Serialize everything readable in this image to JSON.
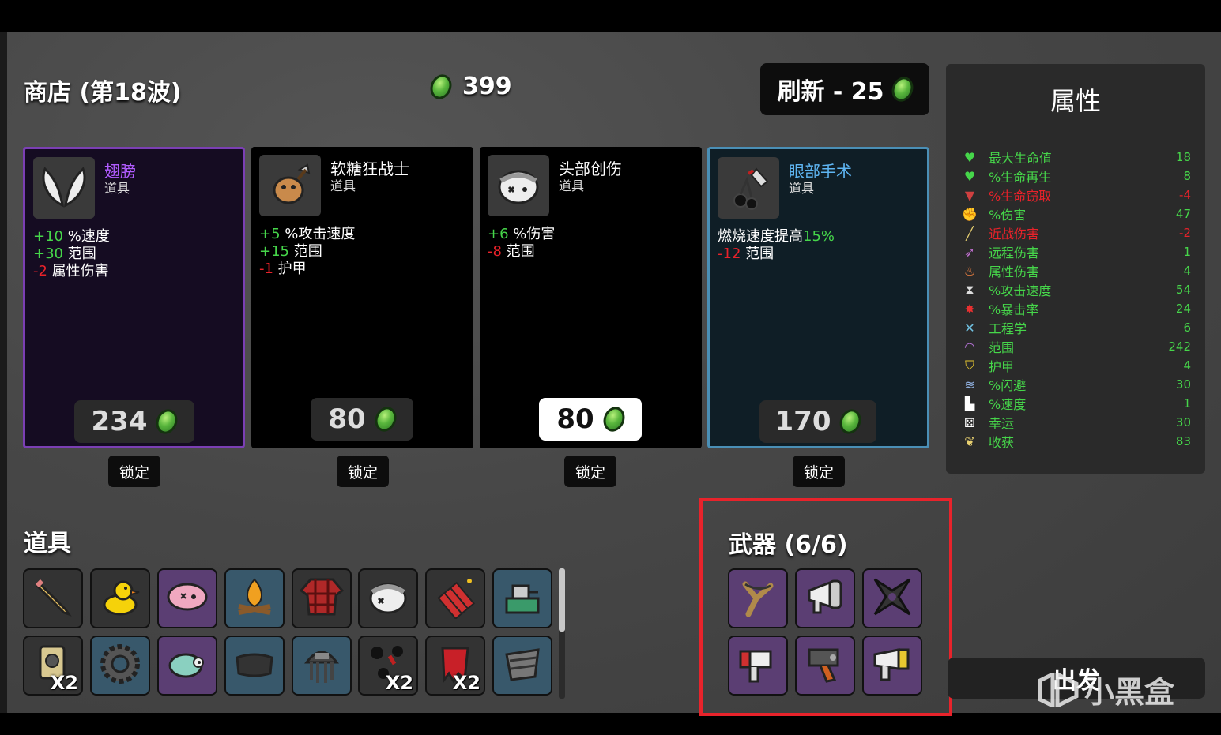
{
  "shop": {
    "title": "商店 (第18波)",
    "materials": "399",
    "refresh_label": "刷新 - 25"
  },
  "cards": [
    {
      "name": "翅膀",
      "type": "道具",
      "name_color": "#b15cff",
      "price": "234",
      "lock": "锁定",
      "icon": "wings-icon",
      "stats": [
        {
          "val": "+10",
          "text": " %速度",
          "kind": "pos"
        },
        {
          "val": "+30",
          "text": " 范围",
          "kind": "pos"
        },
        {
          "val": "-2",
          "text": " 属性伤害",
          "kind": "neg"
        }
      ]
    },
    {
      "name": "软糖狂战士",
      "type": "道具",
      "name_color": "#ffffff",
      "price": "80",
      "lock": "锁定",
      "icon": "gummy-berserker-icon",
      "stats": [
        {
          "val": "+5",
          "text": " %攻击速度",
          "kind": "pos"
        },
        {
          "val": "+15",
          "text": " 范围",
          "kind": "pos"
        },
        {
          "val": "-1",
          "text": " 护甲",
          "kind": "neg"
        }
      ]
    },
    {
      "name": "头部创伤",
      "type": "道具",
      "name_color": "#ffffff",
      "price": "80",
      "lock": "锁定",
      "icon": "head-injury-icon",
      "stats": [
        {
          "val": "+6",
          "text": " %伤害",
          "kind": "pos"
        },
        {
          "val": "-8",
          "text": " 范围",
          "kind": "neg"
        }
      ]
    },
    {
      "name": "眼部手术",
      "type": "道具",
      "name_color": "#5eb5f2",
      "price": "170",
      "lock": "锁定",
      "icon": "eye-surgery-icon",
      "stats": [
        {
          "val": "",
          "text": "燃烧速度提高",
          "extra": "15%",
          "kind": "mix"
        },
        {
          "val": "-12",
          "text": " 范围",
          "kind": "neg"
        }
      ]
    }
  ],
  "items": {
    "title": "道具",
    "row1": [
      {
        "icon": "pencil-icon",
        "bg": "dark"
      },
      {
        "icon": "duck-icon",
        "bg": "dark"
      },
      {
        "icon": "brain-icon",
        "bg": "purple"
      },
      {
        "icon": "campfire-icon",
        "bg": "blue"
      },
      {
        "icon": "plaid-shirt-icon",
        "bg": "dark"
      },
      {
        "icon": "head-injury-icon",
        "bg": "dark"
      },
      {
        "icon": "dynamite-icon",
        "bg": "dark"
      },
      {
        "icon": "machine-icon",
        "bg": "blue"
      }
    ],
    "row2": [
      {
        "icon": "speaker-icon",
        "bg": "dark",
        "count": "X2"
      },
      {
        "icon": "gear-icon",
        "bg": "blue"
      },
      {
        "icon": "chameleon-icon",
        "bg": "purple"
      },
      {
        "icon": "scarf-icon",
        "bg": "blue"
      },
      {
        "icon": "jellyfish-icon",
        "bg": "blue"
      },
      {
        "icon": "bloody-dots-icon",
        "bg": "dark",
        "count": "X2"
      },
      {
        "icon": "red-flag-icon",
        "bg": "dark",
        "count": "X2"
      },
      {
        "icon": "bucket-icon",
        "bg": "blue"
      }
    ]
  },
  "weapons": {
    "title": "武器 (6/6)",
    "slots": [
      {
        "icon": "slingshot-icon"
      },
      {
        "icon": "megaphone-icon"
      },
      {
        "icon": "shuriken-icon"
      },
      {
        "icon": "nail-gun-icon"
      },
      {
        "icon": "drill-gun-icon"
      },
      {
        "icon": "laser-gun-icon"
      }
    ]
  },
  "stats": {
    "title": "属性",
    "rows": [
      {
        "label": "最大生命值",
        "value": "18",
        "color": "#46d64a",
        "icon": "heart-icon",
        "glyph": "♥",
        "icolor": "#46d64a"
      },
      {
        "label": "%生命再生",
        "value": "8",
        "color": "#46d64a",
        "icon": "heart-plus-icon",
        "glyph": "♥",
        "icolor": "#46d64a"
      },
      {
        "label": "%生命窃取",
        "value": "-4",
        "color": "#e8222a",
        "icon": "fangs-icon",
        "glyph": "▼",
        "icolor": "#d04040"
      },
      {
        "label": "%伤害",
        "value": "47",
        "color": "#46d64a",
        "icon": "muscle-icon",
        "glyph": "✊",
        "icolor": "#e07070"
      },
      {
        "label": "近战伤害",
        "value": "-2",
        "color": "#e8222a",
        "icon": "sword-icon",
        "glyph": "╱",
        "icolor": "#e8d070"
      },
      {
        "label": "远程伤害",
        "value": "1",
        "color": "#46d64a",
        "icon": "bow-icon",
        "glyph": "➶",
        "icolor": "#c070d0"
      },
      {
        "label": "属性伤害",
        "value": "4",
        "color": "#46d64a",
        "icon": "fire-icon",
        "glyph": "♨",
        "icolor": "#f08040"
      },
      {
        "label": "%攻击速度",
        "value": "54",
        "color": "#46d64a",
        "icon": "hourglass-icon",
        "glyph": "⧗",
        "icolor": "#dddddd"
      },
      {
        "label": "%暴击率",
        "value": "24",
        "color": "#46d64a",
        "icon": "crit-icon",
        "glyph": "✸",
        "icolor": "#e83030"
      },
      {
        "label": "工程学",
        "value": "6",
        "color": "#46d64a",
        "icon": "wrench-icon",
        "glyph": "✕",
        "icolor": "#70c0e0"
      },
      {
        "label": "范围",
        "value": "242",
        "color": "#46d64a",
        "icon": "range-icon",
        "glyph": "◠",
        "icolor": "#b070d0"
      },
      {
        "label": "护甲",
        "value": "4",
        "color": "#46d64a",
        "icon": "shield-icon",
        "glyph": "⛉",
        "icolor": "#e8c830"
      },
      {
        "label": "%闪避",
        "value": "30",
        "color": "#46d64a",
        "icon": "dodge-icon",
        "glyph": "≋",
        "icolor": "#90b0e0"
      },
      {
        "label": "%速度",
        "value": "1",
        "color": "#46d64a",
        "icon": "boot-icon",
        "glyph": "▙",
        "icolor": "#ffffff"
      },
      {
        "label": "幸运",
        "value": "30",
        "color": "#46d64a",
        "icon": "dice-icon",
        "glyph": "⚄",
        "icolor": "#ffffff"
      },
      {
        "label": "收获",
        "value": "83",
        "color": "#46d64a",
        "icon": "wheat-icon",
        "glyph": "❦",
        "icolor": "#e8d070"
      }
    ]
  },
  "go_button": "出发",
  "watermark": "小黑盒"
}
